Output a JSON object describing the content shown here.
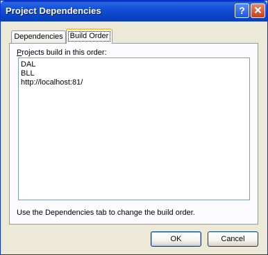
{
  "window": {
    "title": "Project Dependencies",
    "help_glyph": "?",
    "close_icon": "close-icon"
  },
  "tabs": [
    {
      "label": "Dependencies",
      "selected": false
    },
    {
      "label": "Build Order",
      "selected": true
    }
  ],
  "panel": {
    "label_prefix": "P",
    "label_rest": "rojects build in this order:",
    "items": [
      "DAL",
      "BLL",
      "http://localhost:81/"
    ],
    "hint": "Use the Dependencies tab to change the build order."
  },
  "buttons": {
    "ok": "OK",
    "cancel": "Cancel"
  },
  "colors": {
    "titlebar": "#0c45c8",
    "dialog_bg": "#ece9d8",
    "tab_highlight": "#ffc83c"
  }
}
